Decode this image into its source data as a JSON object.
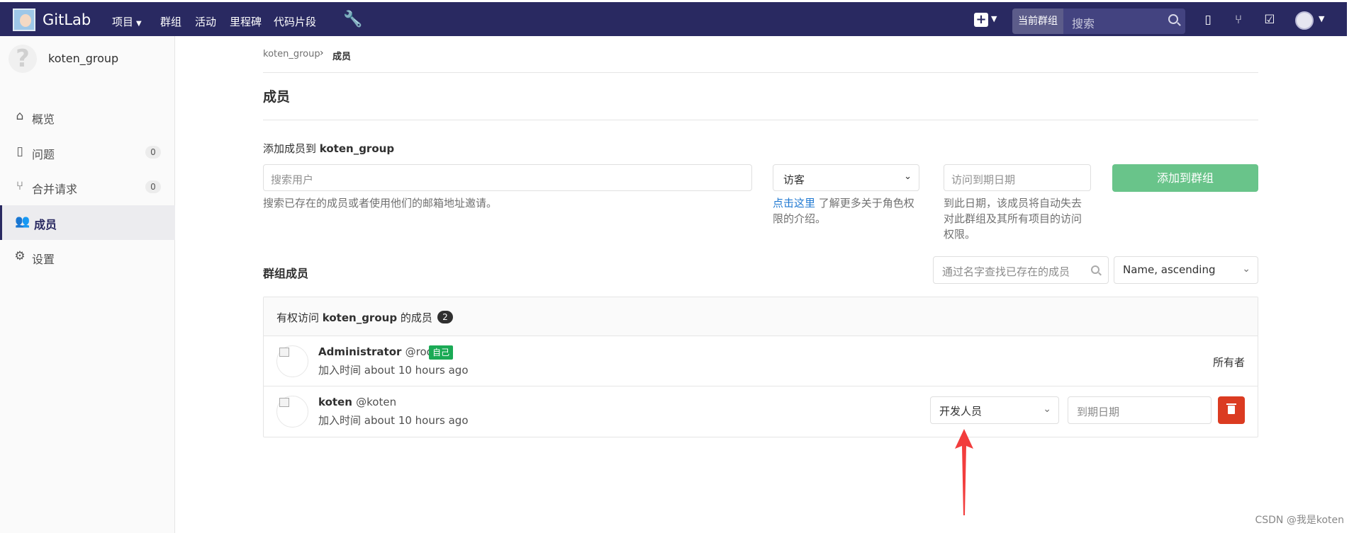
{
  "navbar": {
    "brand": "GitLab",
    "links": [
      "项目",
      "群组",
      "活动",
      "里程碑",
      "代码片段"
    ],
    "search_scope": "当前群组",
    "search_placeholder": "搜索"
  },
  "sidebar": {
    "group_name": "koten_group",
    "items": [
      {
        "label": "概览",
        "icon": "home-icon"
      },
      {
        "label": "问题",
        "icon": "issues-icon",
        "count": "0"
      },
      {
        "label": "合并请求",
        "icon": "merge-request-icon",
        "count": "0"
      },
      {
        "label": "成员",
        "icon": "users-icon"
      },
      {
        "label": "设置",
        "icon": "gear-icon"
      }
    ],
    "active_index": 3
  },
  "breadcrumb": {
    "parent": "koten_group",
    "current": "成员"
  },
  "page_title": "成员",
  "add_member": {
    "label_prefix": "添加成员到",
    "label_group": "koten_group",
    "search_placeholder": "搜索用户",
    "search_help": "搜索已存在的成员或者使用他们的邮箱地址邀请。",
    "role_value": "访客",
    "role_help_link": "点击这里",
    "role_help_text": "了解更多关于角色权限的介绍。",
    "expiry_placeholder": "访问到期日期",
    "expiry_help": "到此日期，该成员将自动失去对此群组及其所有项目的访问权限。",
    "add_button": "添加到群组"
  },
  "members": {
    "title": "群组成员",
    "filter_placeholder": "通过名字查找已存在的成员",
    "sort_value": "Name, ascending",
    "panel_prefix": "有权访问",
    "panel_group": "koten_group",
    "panel_suffix": "的成员",
    "count": "2",
    "list": [
      {
        "name": "Administrator",
        "username": "@root",
        "badge": "自己",
        "joined": "加入时间 about 10 hours ago",
        "role": "所有者"
      },
      {
        "name": "koten",
        "username": "@koten",
        "joined": "加入时间 about 10 hours ago",
        "role_select": "开发人员",
        "expiry_placeholder": "到期日期"
      }
    ]
  },
  "colors": {
    "navbar": "#292961",
    "add_button": "#69c48a",
    "delete_button": "#db3b21",
    "arrow": "#f23d3d"
  },
  "watermark": "CSDN @我是koten"
}
